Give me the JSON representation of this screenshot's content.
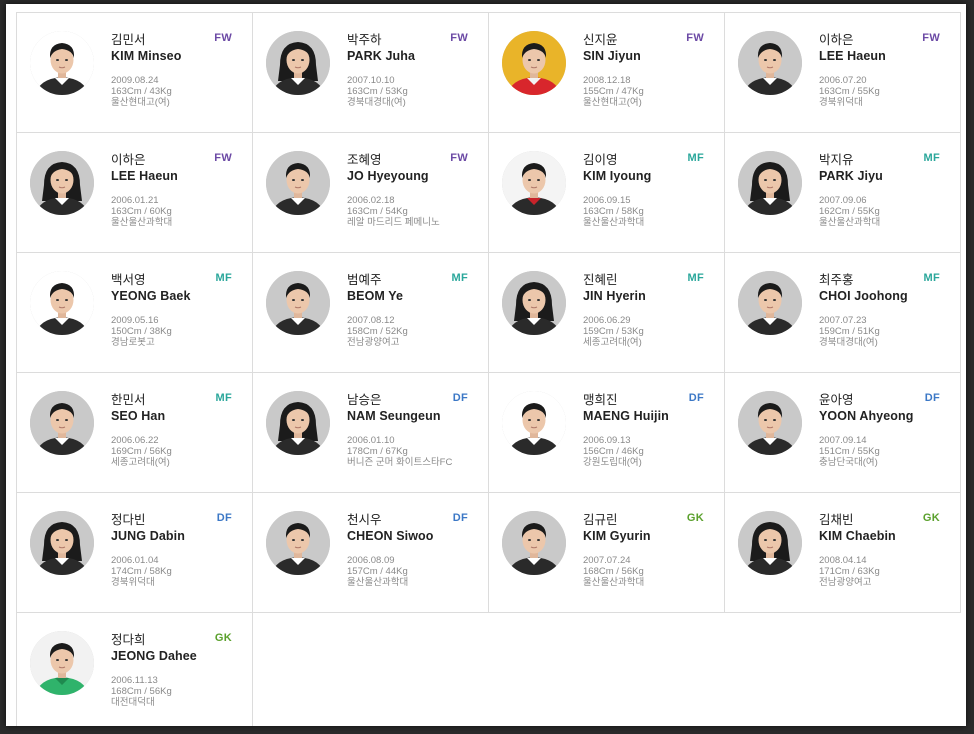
{
  "colors": {
    "FW": "#6c4aa5",
    "MF": "#2aa79b",
    "DF": "#3c78c6",
    "GK": "#5aa02c"
  },
  "players": [
    {
      "kname": "김민서",
      "ename": "KIM Minseo",
      "pos": "FW",
      "birth": "2009.08.24",
      "body": "163Cm / 43Kg",
      "school": "울산현대고(여)",
      "photo": "white"
    },
    {
      "kname": "박주하",
      "ename": "PARK Juha",
      "pos": "FW",
      "birth": "2007.10.10",
      "body": "163Cm / 53Kg",
      "school": "경북대경대(여)",
      "photo": "grey"
    },
    {
      "kname": "신지윤",
      "ename": "SIN Jiyun",
      "pos": "FW",
      "birth": "2008.12.18",
      "body": "155Cm / 47Kg",
      "school": "울산현대고(여)",
      "photo": "yellow"
    },
    {
      "kname": "이하은",
      "ename": "LEE Haeun",
      "pos": "FW",
      "birth": "2006.07.20",
      "body": "163Cm / 55Kg",
      "school": "경북위덕대",
      "photo": "grey"
    },
    {
      "kname": "이하은",
      "ename": "LEE Haeun",
      "pos": "FW",
      "birth": "2006.01.21",
      "body": "163Cm / 60Kg",
      "school": "울산울산과학대",
      "photo": "grey"
    },
    {
      "kname": "조혜영",
      "ename": "JO Hyeyoung",
      "pos": "FW",
      "birth": "2006.02.18",
      "body": "163Cm / 54Kg",
      "school": "레알 마드리드 페메니노",
      "photo": "grey"
    },
    {
      "kname": "김이영",
      "ename": "KIM Iyoung",
      "pos": "MF",
      "birth": "2006.09.15",
      "body": "163Cm / 58Kg",
      "school": "울산울산과학대",
      "photo": "white-red"
    },
    {
      "kname": "박지유",
      "ename": "PARK Jiyu",
      "pos": "MF",
      "birth": "2007.09.06",
      "body": "162Cm / 55Kg",
      "school": "울산울산과학대",
      "photo": "grey"
    },
    {
      "kname": "백서영",
      "ename": "YEONG Baek",
      "pos": "MF",
      "birth": "2009.05.16",
      "body": "150Cm / 38Kg",
      "school": "경남로봇고",
      "photo": "white"
    },
    {
      "kname": "범예주",
      "ename": "BEOM Ye",
      "pos": "MF",
      "birth": "2007.08.12",
      "body": "158Cm / 52Kg",
      "school": "전남광양여고",
      "photo": "grey"
    },
    {
      "kname": "진혜린",
      "ename": "JIN Hyerin",
      "pos": "MF",
      "birth": "2006.06.29",
      "body": "159Cm / 53Kg",
      "school": "세종고려대(여)",
      "photo": "grey"
    },
    {
      "kname": "최주홍",
      "ename": "CHOI Joohong",
      "pos": "MF",
      "birth": "2007.07.23",
      "body": "159Cm / 51Kg",
      "school": "경북대경대(여)",
      "photo": "grey"
    },
    {
      "kname": "한민서",
      "ename": "SEO Han",
      "pos": "MF",
      "birth": "2006.06.22",
      "body": "169Cm / 56Kg",
      "school": "세종고려대(여)",
      "photo": "grey"
    },
    {
      "kname": "남승은",
      "ename": "NAM Seungeun",
      "pos": "DF",
      "birth": "2006.01.10",
      "body": "178Cm / 67Kg",
      "school": "버니즌 군머 화이트스타FC",
      "photo": "grey"
    },
    {
      "kname": "맹희진",
      "ename": "MAENG Huijin",
      "pos": "DF",
      "birth": "2006.09.13",
      "body": "156Cm / 46Kg",
      "school": "강원도립대(여)",
      "photo": "white"
    },
    {
      "kname": "윤아영",
      "ename": "YOON Ahyeong",
      "pos": "DF",
      "birth": "2007.09.14",
      "body": "151Cm / 55Kg",
      "school": "충남단국대(여)",
      "photo": "grey"
    },
    {
      "kname": "정다빈",
      "ename": "JUNG Dabin",
      "pos": "DF",
      "birth": "2006.01.04",
      "body": "174Cm / 58Kg",
      "school": "경북위덕대",
      "photo": "grey"
    },
    {
      "kname": "천시우",
      "ename": "CHEON Siwoo",
      "pos": "DF",
      "birth": "2006.08.09",
      "body": "157Cm / 44Kg",
      "school": "울산울산과학대",
      "photo": "grey"
    },
    {
      "kname": "김규린",
      "ename": "KIM Gyurin",
      "pos": "GK",
      "birth": "2007.07.24",
      "body": "168Cm / 56Kg",
      "school": "울산울산과학대",
      "photo": "grey"
    },
    {
      "kname": "김채빈",
      "ename": "KIM Chaebin",
      "pos": "GK",
      "birth": "2008.04.14",
      "body": "171Cm / 63Kg",
      "school": "전남광양여고",
      "photo": "grey"
    },
    {
      "kname": "정다희",
      "ename": "JEONG Dahee",
      "pos": "GK",
      "birth": "2006.11.13",
      "body": "168Cm / 56Kg",
      "school": "대전대덕대",
      "photo": "white-green"
    }
  ]
}
